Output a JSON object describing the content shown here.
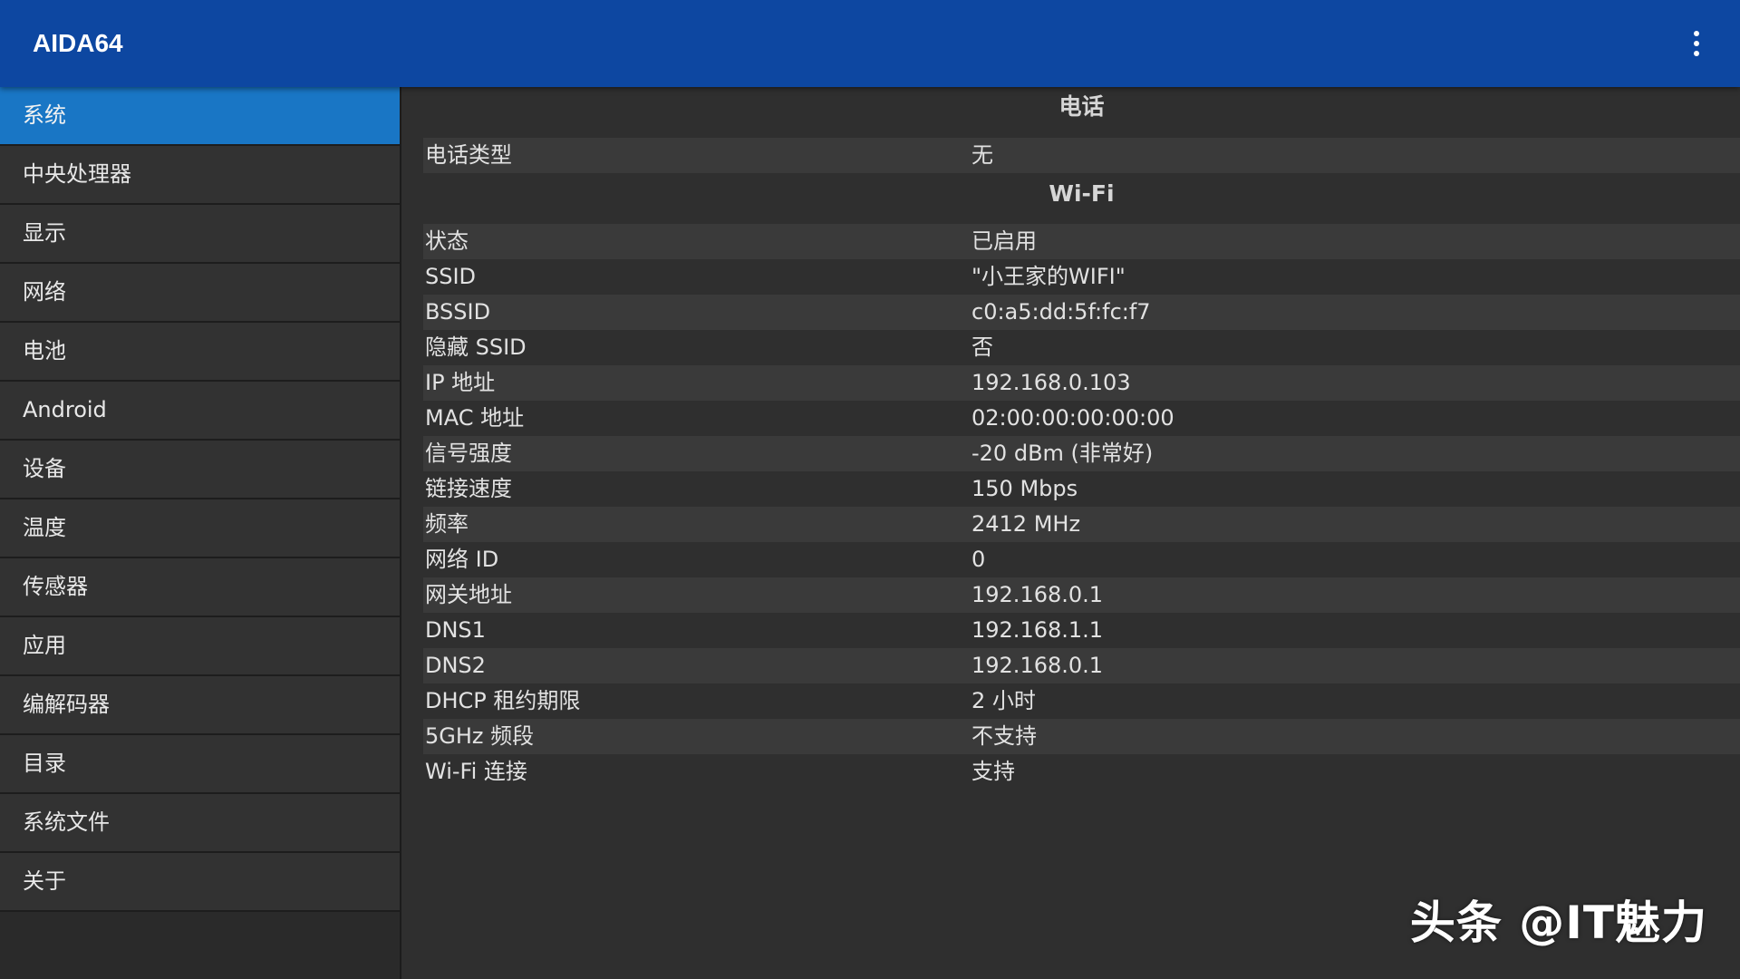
{
  "app": {
    "title": "AIDA64",
    "overflow_icon": "more-vert-icon",
    "colors": {
      "appbar": "#0d47a1",
      "active_item": "#1976c5",
      "background": "#2f2f2f"
    }
  },
  "sidebar": {
    "items": [
      {
        "label": "系统",
        "active": true
      },
      {
        "label": "中央处理器"
      },
      {
        "label": "显示"
      },
      {
        "label": "网络"
      },
      {
        "label": "电池"
      },
      {
        "label": "Android"
      },
      {
        "label": "设备"
      },
      {
        "label": "温度"
      },
      {
        "label": "传感器"
      },
      {
        "label": "应用"
      },
      {
        "label": "编解码器"
      },
      {
        "label": "目录"
      },
      {
        "label": "系统文件"
      },
      {
        "label": "关于"
      }
    ]
  },
  "main": {
    "phone": {
      "title": "电话",
      "rows": [
        {
          "key": "电话类型",
          "value": "无"
        }
      ]
    },
    "wifi": {
      "title": "Wi-Fi",
      "rows": [
        {
          "key": "状态",
          "value": "已启用"
        },
        {
          "key": "SSID",
          "value": "\"小王家的WIFI\""
        },
        {
          "key": "BSSID",
          "value": "c0:a5:dd:5f:fc:f7"
        },
        {
          "key": "隐藏 SSID",
          "value": "否"
        },
        {
          "key": "IP 地址",
          "value": "192.168.0.103"
        },
        {
          "key": "MAC 地址",
          "value": "02:00:00:00:00:00"
        },
        {
          "key": "信号强度",
          "value": "-20 dBm (非常好)"
        },
        {
          "key": "链接速度",
          "value": "150 Mbps"
        },
        {
          "key": "频率",
          "value": "2412 MHz"
        },
        {
          "key": "网络 ID",
          "value": "0"
        },
        {
          "key": "网关地址",
          "value": "192.168.0.1"
        },
        {
          "key": "DNS1",
          "value": "192.168.1.1"
        },
        {
          "key": "DNS2",
          "value": "192.168.0.1"
        },
        {
          "key": "DHCP 租约期限",
          "value": "2 小时"
        },
        {
          "key": "5GHz 频段",
          "value": "不支持"
        },
        {
          "key": "Wi-Fi 连接",
          "value": "支持"
        }
      ]
    }
  },
  "watermark": {
    "text": "头条 @IT魅力"
  }
}
